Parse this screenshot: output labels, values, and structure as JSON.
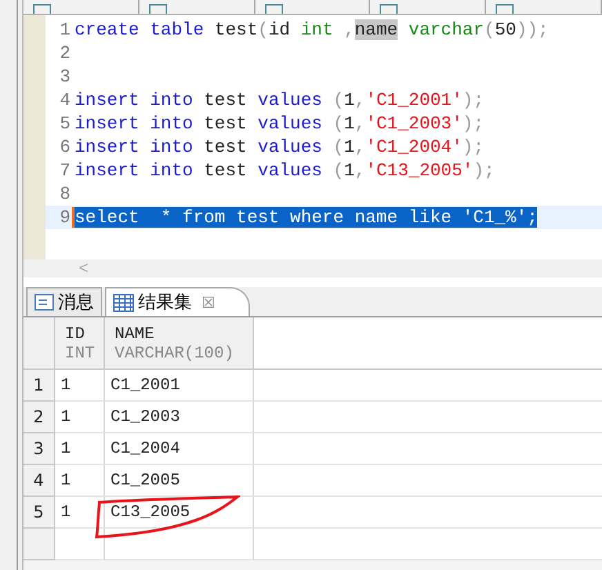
{
  "editor_tabs": [
    {
      "selected": false
    },
    {
      "selected": false
    },
    {
      "selected": false
    },
    {
      "selected": false
    },
    {
      "selected": false
    }
  ],
  "editor": {
    "lines": [
      {
        "number": "1",
        "selected": false,
        "tokens": [
          {
            "text": "create",
            "kind": "keyword"
          },
          {
            "text": " table",
            "kind": "keyword"
          },
          {
            "text": " test",
            "kind": "plain"
          },
          {
            "text": "(",
            "kind": "punct"
          },
          {
            "text": "id ",
            "kind": "plain"
          },
          {
            "text": "int",
            "kind": "type"
          },
          {
            "text": " ,",
            "kind": "punct"
          },
          {
            "text": "name",
            "kind": "marked"
          },
          {
            "text": " varchar",
            "kind": "type"
          },
          {
            "text": "(",
            "kind": "punct"
          },
          {
            "text": "50",
            "kind": "plain"
          },
          {
            "text": "));",
            "kind": "punct"
          }
        ]
      },
      {
        "number": "2",
        "selected": false
      },
      {
        "number": "3",
        "selected": false
      },
      {
        "number": "4",
        "selected": false,
        "tokens": [
          {
            "text": "insert",
            "kind": "keyword"
          },
          {
            "text": " into",
            "kind": "keyword"
          },
          {
            "text": " test ",
            "kind": "plain"
          },
          {
            "text": "values",
            "kind": "keyword"
          },
          {
            "text": " (",
            "kind": "punct"
          },
          {
            "text": "1",
            "kind": "plain"
          },
          {
            "text": ",",
            "kind": "punct"
          },
          {
            "text": "'C1_2001'",
            "kind": "string"
          },
          {
            "text": ");",
            "kind": "punct"
          }
        ]
      },
      {
        "number": "5",
        "selected": false,
        "tokens": [
          {
            "text": "insert",
            "kind": "keyword"
          },
          {
            "text": " into",
            "kind": "keyword"
          },
          {
            "text": " test ",
            "kind": "plain"
          },
          {
            "text": "values",
            "kind": "keyword"
          },
          {
            "text": " (",
            "kind": "punct"
          },
          {
            "text": "1",
            "kind": "plain"
          },
          {
            "text": ",",
            "kind": "punct"
          },
          {
            "text": "'C1_2003'",
            "kind": "string"
          },
          {
            "text": ");",
            "kind": "punct"
          }
        ]
      },
      {
        "number": "6",
        "selected": false,
        "tokens": [
          {
            "text": "insert",
            "kind": "keyword"
          },
          {
            "text": " into",
            "kind": "keyword"
          },
          {
            "text": " test ",
            "kind": "plain"
          },
          {
            "text": "values",
            "kind": "keyword"
          },
          {
            "text": " (",
            "kind": "punct"
          },
          {
            "text": "1",
            "kind": "plain"
          },
          {
            "text": ",",
            "kind": "punct"
          },
          {
            "text": "'C1_2004'",
            "kind": "string"
          },
          {
            "text": ");",
            "kind": "punct"
          }
        ]
      },
      {
        "number": "7",
        "selected": false,
        "tokens": [
          {
            "text": "insert",
            "kind": "keyword"
          },
          {
            "text": " into",
            "kind": "keyword"
          },
          {
            "text": " test ",
            "kind": "plain"
          },
          {
            "text": "values",
            "kind": "keyword"
          },
          {
            "text": " (",
            "kind": "punct"
          },
          {
            "text": "1",
            "kind": "plain"
          },
          {
            "text": ",",
            "kind": "punct"
          },
          {
            "text": "'C13_2005'",
            "kind": "string"
          },
          {
            "text": ");",
            "kind": "punct"
          }
        ]
      },
      {
        "number": "8",
        "selected": false
      },
      {
        "number": "9",
        "selected": true,
        "tokens": [
          {
            "text": "select  * from test where name like 'C1_%';",
            "kind": "plain"
          }
        ]
      }
    ],
    "scroll_left": "<"
  },
  "result_tabs": [
    {
      "label": "消息",
      "selected": false
    },
    {
      "label": "结果集",
      "selected": true,
      "close": "☒"
    }
  ],
  "table": {
    "columns": [
      {
        "name": "ID",
        "type": "INT"
      },
      {
        "name": "NAME",
        "type": "VARCHAR(100)"
      }
    ],
    "rows": [
      {
        "number": "1",
        "cells": [
          "1",
          "C1_2001"
        ]
      },
      {
        "number": "2",
        "cells": [
          "1",
          "C1_2003"
        ]
      },
      {
        "number": "3",
        "cells": [
          "1",
          "C1_2004"
        ]
      },
      {
        "number": "4",
        "cells": [
          "1",
          "C1_2005"
        ]
      },
      {
        "number": "5",
        "cells": [
          "1",
          "C13_2005"
        ]
      }
    ]
  }
}
